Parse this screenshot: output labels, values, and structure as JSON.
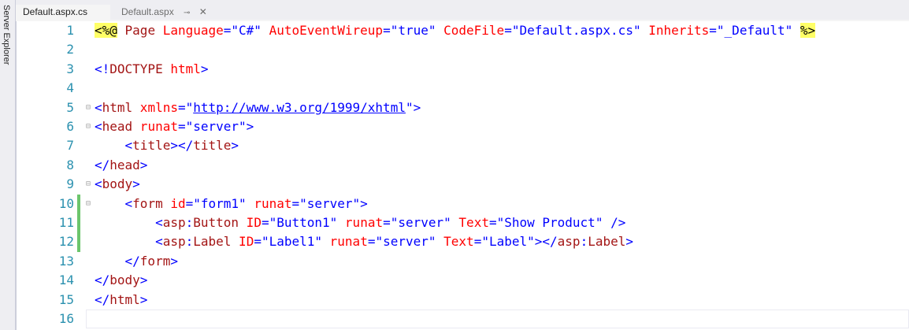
{
  "side_panel": {
    "label": "Server Explorer"
  },
  "tabs": [
    {
      "label": "Default.aspx.cs",
      "active": true
    },
    {
      "label": "Default.aspx",
      "active": false,
      "pin_icon": "pin-icon",
      "close_icon": "close-icon",
      "pin_glyph": "⊸",
      "close_glyph": "✕"
    }
  ],
  "colors": {
    "line_number": "#2b91af",
    "keyword_blue": "#0000ff",
    "tag_maroon": "#a31515",
    "attribute_red": "#ff0000",
    "directive_highlight": "#ffff66",
    "change_bar_green": "#6cc56c"
  },
  "editor": {
    "lines": [
      {
        "num": "1",
        "fold": "",
        "changed": false,
        "tokens": [
          {
            "t": "<%@",
            "c": "dir"
          },
          {
            "t": " Page ",
            "c": "maroon"
          },
          {
            "t": "Language",
            "c": "red"
          },
          {
            "t": "=\"C#\" ",
            "c": "blue"
          },
          {
            "t": "AutoEventWireup",
            "c": "red"
          },
          {
            "t": "=\"true\" ",
            "c": "blue"
          },
          {
            "t": "CodeFile",
            "c": "red"
          },
          {
            "t": "=\"Default.aspx.cs\" ",
            "c": "blue"
          },
          {
            "t": "Inherits",
            "c": "red"
          },
          {
            "t": "=\"_Default\" ",
            "c": "blue"
          },
          {
            "t": "%>",
            "c": "dir"
          }
        ]
      },
      {
        "num": "2",
        "fold": "",
        "changed": false,
        "tokens": []
      },
      {
        "num": "3",
        "fold": "",
        "changed": false,
        "tokens": [
          {
            "t": "<!",
            "c": "blue"
          },
          {
            "t": "DOCTYPE",
            "c": "maroon"
          },
          {
            "t": " html",
            "c": "red"
          },
          {
            "t": ">",
            "c": "blue"
          }
        ]
      },
      {
        "num": "4",
        "fold": "",
        "changed": false,
        "tokens": []
      },
      {
        "num": "5",
        "fold": "⊟",
        "changed": false,
        "tokens": [
          {
            "t": "<",
            "c": "blue"
          },
          {
            "t": "html",
            "c": "maroon"
          },
          {
            "t": " xmlns",
            "c": "red"
          },
          {
            "t": "=\"",
            "c": "blue"
          },
          {
            "t": "http://www.w3.org/1999/xhtml",
            "c": "link"
          },
          {
            "t": "\">",
            "c": "blue"
          }
        ]
      },
      {
        "num": "6",
        "fold": "⊟",
        "changed": false,
        "tokens": [
          {
            "t": "<",
            "c": "blue"
          },
          {
            "t": "head",
            "c": "maroon"
          },
          {
            "t": " runat",
            "c": "red"
          },
          {
            "t": "=\"server\">",
            "c": "blue"
          }
        ]
      },
      {
        "num": "7",
        "fold": "",
        "changed": false,
        "tokens": [
          {
            "t": "    <",
            "c": "blue"
          },
          {
            "t": "title",
            "c": "maroon"
          },
          {
            "t": "></",
            "c": "blue"
          },
          {
            "t": "title",
            "c": "maroon"
          },
          {
            "t": ">",
            "c": "blue"
          }
        ]
      },
      {
        "num": "8",
        "fold": "",
        "changed": false,
        "tokens": [
          {
            "t": "</",
            "c": "blue"
          },
          {
            "t": "head",
            "c": "maroon"
          },
          {
            "t": ">",
            "c": "blue"
          }
        ]
      },
      {
        "num": "9",
        "fold": "⊟",
        "changed": false,
        "tokens": [
          {
            "t": "<",
            "c": "blue"
          },
          {
            "t": "body",
            "c": "maroon"
          },
          {
            "t": ">",
            "c": "blue"
          }
        ]
      },
      {
        "num": "10",
        "fold": "⊟",
        "changed": true,
        "tokens": [
          {
            "t": "    <",
            "c": "blue"
          },
          {
            "t": "form",
            "c": "maroon"
          },
          {
            "t": " id",
            "c": "red"
          },
          {
            "t": "=\"form1\" ",
            "c": "blue"
          },
          {
            "t": "runat",
            "c": "red"
          },
          {
            "t": "=\"server\">",
            "c": "blue"
          }
        ]
      },
      {
        "num": "11",
        "fold": "",
        "changed": true,
        "tokens": [
          {
            "t": "        <",
            "c": "blue"
          },
          {
            "t": "asp",
            "c": "maroon"
          },
          {
            "t": ":",
            "c": "blue"
          },
          {
            "t": "Button",
            "c": "maroon"
          },
          {
            "t": " ID",
            "c": "red"
          },
          {
            "t": "=\"Button1\" ",
            "c": "blue"
          },
          {
            "t": "runat",
            "c": "red"
          },
          {
            "t": "=\"server\" ",
            "c": "blue"
          },
          {
            "t": "Text",
            "c": "red"
          },
          {
            "t": "=\"Show Product\" />",
            "c": "blue"
          }
        ]
      },
      {
        "num": "12",
        "fold": "",
        "changed": true,
        "tokens": [
          {
            "t": "        <",
            "c": "blue"
          },
          {
            "t": "asp",
            "c": "maroon"
          },
          {
            "t": ":",
            "c": "blue"
          },
          {
            "t": "Label",
            "c": "maroon"
          },
          {
            "t": " ID",
            "c": "red"
          },
          {
            "t": "=\"Label1\" ",
            "c": "blue"
          },
          {
            "t": "runat",
            "c": "red"
          },
          {
            "t": "=\"server\" ",
            "c": "blue"
          },
          {
            "t": "Text",
            "c": "red"
          },
          {
            "t": "=\"Label\"></",
            "c": "blue"
          },
          {
            "t": "asp",
            "c": "maroon"
          },
          {
            "t": ":",
            "c": "blue"
          },
          {
            "t": "Label",
            "c": "maroon"
          },
          {
            "t": ">",
            "c": "blue"
          }
        ]
      },
      {
        "num": "13",
        "fold": "",
        "changed": false,
        "tokens": [
          {
            "t": "    </",
            "c": "blue"
          },
          {
            "t": "form",
            "c": "maroon"
          },
          {
            "t": ">",
            "c": "blue"
          }
        ]
      },
      {
        "num": "14",
        "fold": "",
        "changed": false,
        "tokens": [
          {
            "t": "</",
            "c": "blue"
          },
          {
            "t": "body",
            "c": "maroon"
          },
          {
            "t": ">",
            "c": "blue"
          }
        ]
      },
      {
        "num": "15",
        "fold": "",
        "changed": false,
        "tokens": [
          {
            "t": "</",
            "c": "blue"
          },
          {
            "t": "html",
            "c": "maroon"
          },
          {
            "t": ">",
            "c": "blue"
          }
        ]
      },
      {
        "num": "16",
        "fold": "",
        "changed": false,
        "current": true,
        "tokens": []
      }
    ]
  }
}
